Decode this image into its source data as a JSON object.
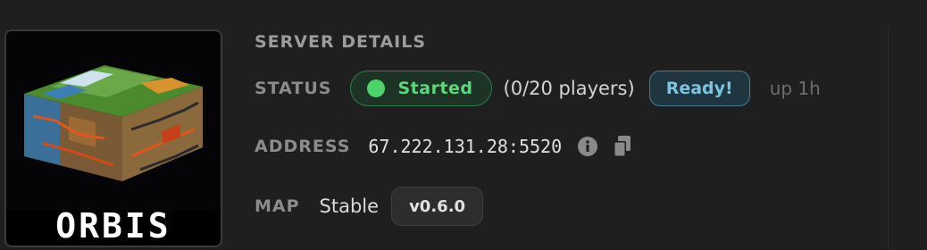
{
  "server": {
    "thumbnail_label": "ORBIS",
    "thumbnail_icon": "voxel-world-cube-image"
  },
  "details": {
    "section_title": "SERVER DETAILS",
    "status_label": "STATUS",
    "status_value": "Started",
    "players": "(0/20 players)",
    "ready_badge": "Ready!",
    "uptime": "up 1h",
    "address_label": "ADDRESS",
    "address_value": "67.222.131.28:5520",
    "info_icon": "info-icon",
    "copy_icon": "copy-icon",
    "map_label": "MAP",
    "map_value": "Stable",
    "version": "v0.6.0"
  },
  "colors": {
    "background": "#1f1f1f",
    "started_green": "#4cd369",
    "ready_blue": "#7cc4e0",
    "label_gray": "#8c8c8c"
  }
}
